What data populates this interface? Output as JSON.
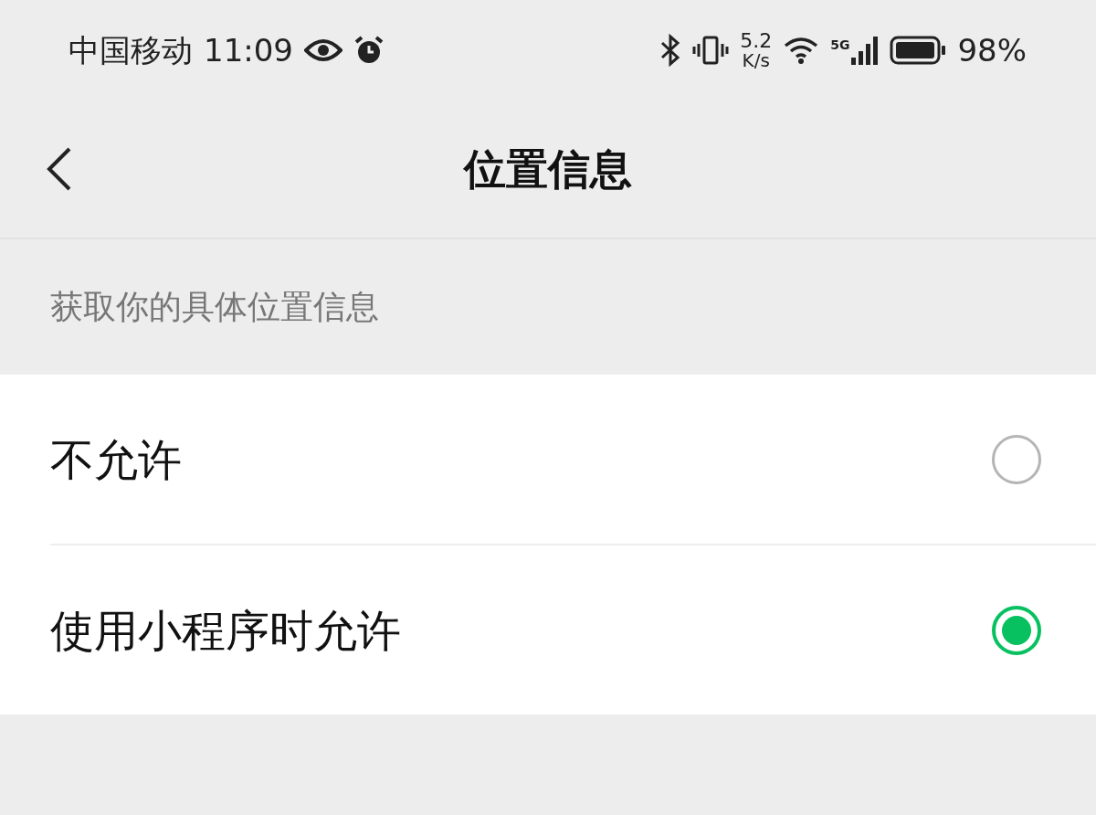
{
  "status_bar": {
    "carrier": "中国移动",
    "time": "11:09",
    "speed_value": "5.2",
    "speed_unit": "K/s",
    "network": "5G",
    "battery": "98%"
  },
  "header": {
    "title": "位置信息"
  },
  "section": {
    "label": "获取你的具体位置信息"
  },
  "options": [
    {
      "label": "不允许",
      "selected": false
    },
    {
      "label": "使用小程序时允许",
      "selected": true
    }
  ]
}
